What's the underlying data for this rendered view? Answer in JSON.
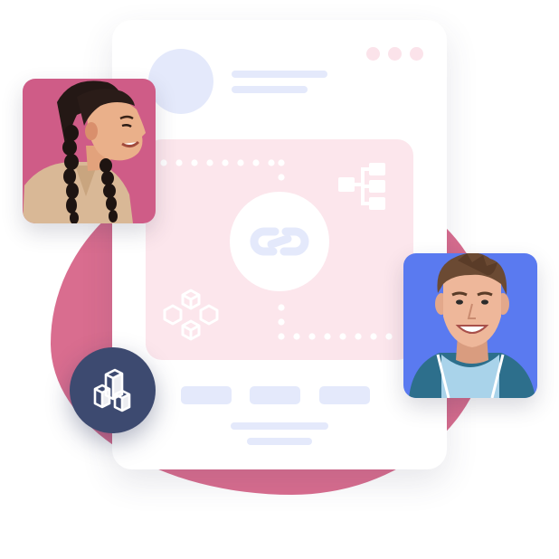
{
  "illustration": {
    "colors": {
      "blob": "#d96d8f",
      "card": "#ffffff",
      "placeholder_blue": "#e4e9fb",
      "panel_pink": "#fce6ec",
      "window_dot": "#fbe3ea",
      "photo_left_bg": "#cf5c87",
      "photo_right_bg": "#5a7af0",
      "badge": "#3d4a70"
    },
    "icons": [
      "link-icon",
      "hierarchy-icon",
      "cube-cluster-icon",
      "stacked-blocks-icon"
    ],
    "photos": [
      "woman-with-braids-photo",
      "smiling-man-photo"
    ]
  }
}
